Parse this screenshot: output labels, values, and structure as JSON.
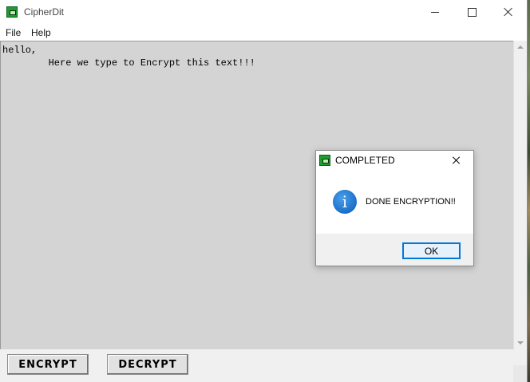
{
  "window": {
    "title": "CipherDit",
    "icon": "cipherdit-app-icon",
    "controls": [
      "minimize-icon",
      "maximize-icon",
      "close-icon"
    ]
  },
  "menu": {
    "items": [
      {
        "label": "File"
      },
      {
        "label": "Help"
      }
    ]
  },
  "editor": {
    "lines": [
      "hello,",
      "        Here we type to Encrypt this text!!!"
    ]
  },
  "actions": {
    "encrypt_label": "ENCRYPT",
    "decrypt_label": "DECRYPT"
  },
  "dialog": {
    "title": "COMPLETED",
    "icon": "information-icon",
    "info_glyph": "i",
    "message": "DONE ENCRYPTION!!",
    "ok_label": "OK"
  },
  "colors": {
    "editor_background": "#d4d4d4",
    "accent": "#0078d7",
    "app_icon_green": "#1f9e2f"
  }
}
